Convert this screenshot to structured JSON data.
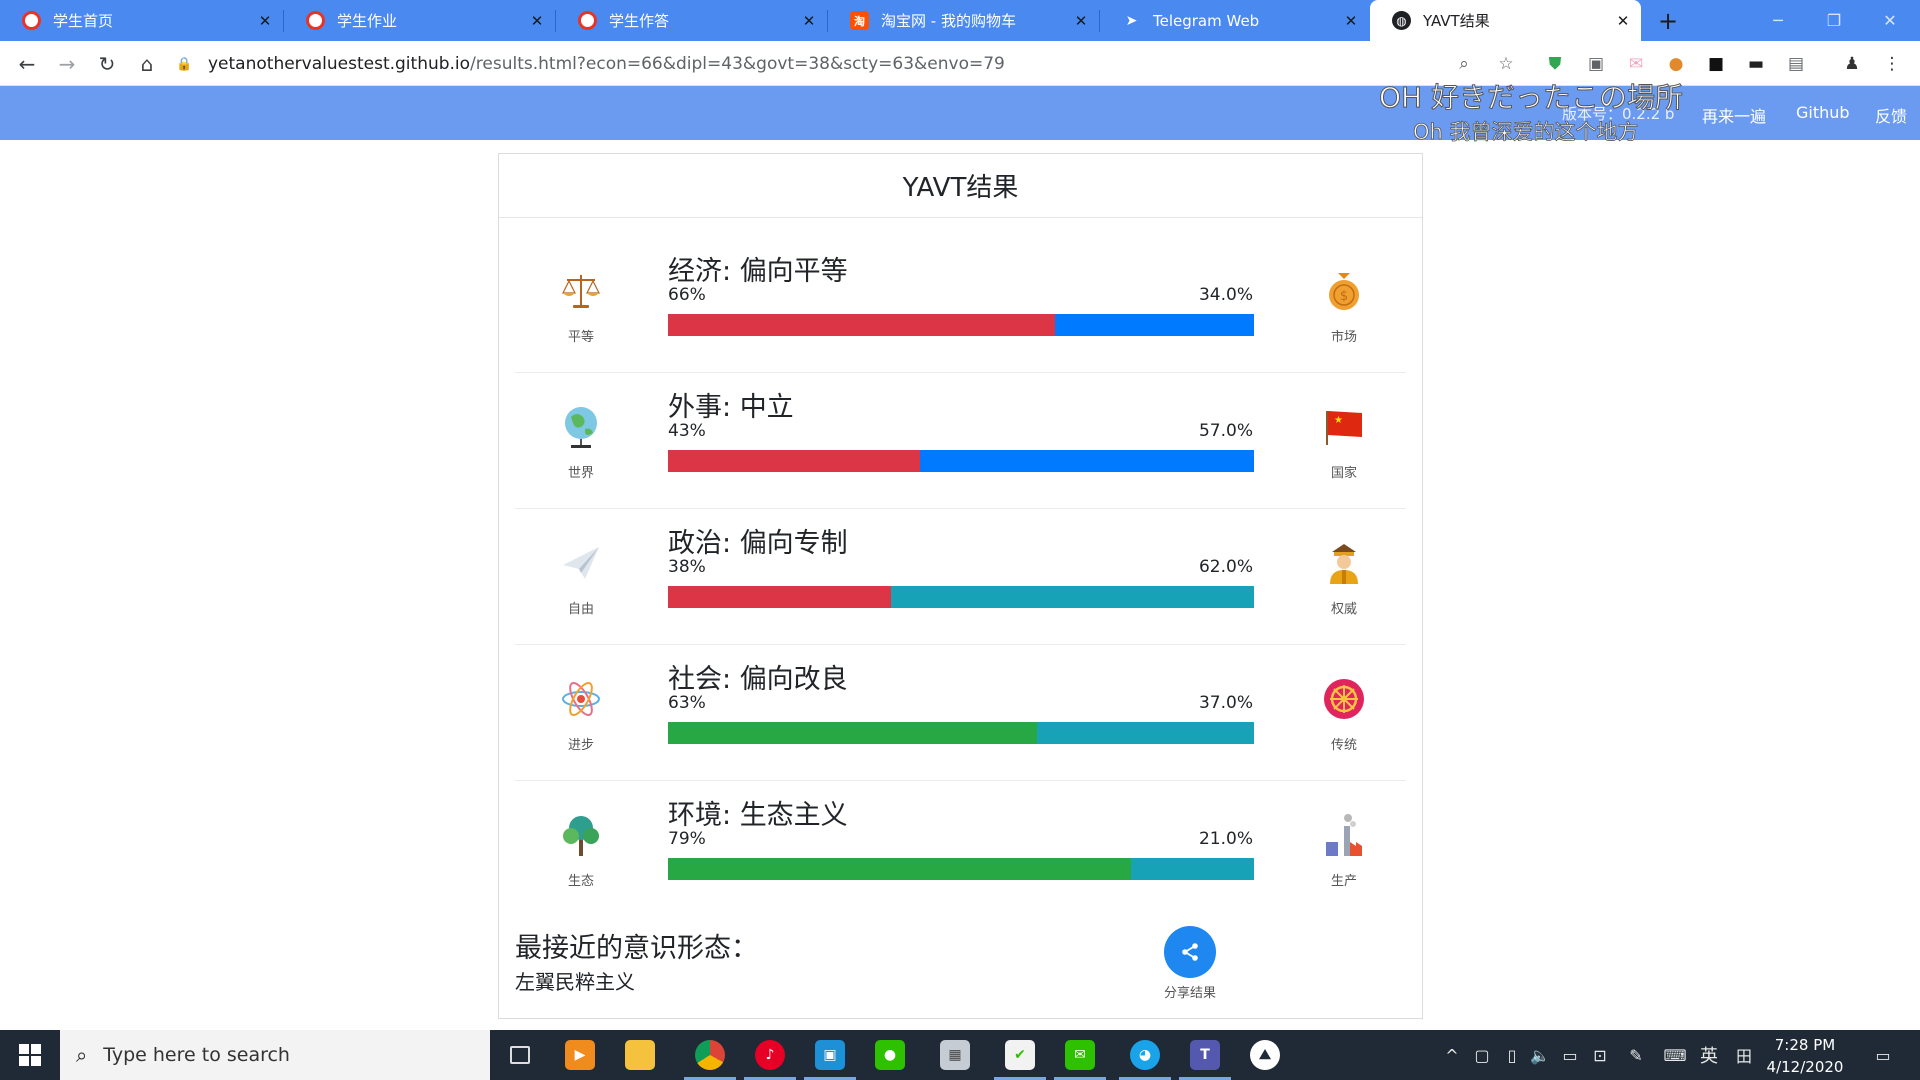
{
  "browser": {
    "tabs": [
      {
        "title": "学生首页",
        "favicon": "school-icon",
        "color": "#e8332a"
      },
      {
        "title": "学生作业",
        "favicon": "school-icon",
        "color": "#e8332a"
      },
      {
        "title": "学生作答",
        "favicon": "school-icon",
        "color": "#e8332a"
      },
      {
        "title": "淘宝网 - 我的购物车",
        "favicon": "taobao-icon",
        "color": "#ff5000"
      },
      {
        "title": "Telegram Web",
        "favicon": "telegram-icon",
        "color": "#2ca5e0"
      },
      {
        "title": "YAVT结果",
        "favicon": "globe-icon",
        "color": "#202124",
        "active": true
      }
    ],
    "url_host": "yetanothervaluestest.github.io",
    "url_path": "/results.html?econ=66&dipl=43&govt=38&scty=63&envo=79"
  },
  "site_nav": {
    "version": "版本号：0.2.2 b",
    "links": [
      "再来一遍",
      "Github",
      "反馈"
    ]
  },
  "overlay_lyrics": {
    "line1": "OH 好きだったこの場所",
    "line2": "Oh 我曾深爱的这个地方"
  },
  "results": {
    "title": "YAVT结果",
    "axes": [
      {
        "category": "经济",
        "verdict": "偏向平等",
        "left_label": "平等",
        "right_label": "市场",
        "left_pct": "66%",
        "right_pct": "34.0%",
        "left_value": 66,
        "left_color": "#dc3545",
        "right_color": "#007bff",
        "left_icon": "scales-icon",
        "right_icon": "money-bag-icon"
      },
      {
        "category": "外事",
        "verdict": "中立",
        "left_label": "世界",
        "right_label": "国家",
        "left_pct": "43%",
        "right_pct": "57.0%",
        "left_value": 43,
        "left_color": "#dc3545",
        "right_color": "#007bff",
        "left_icon": "globe-icon",
        "right_icon": "flag-icon"
      },
      {
        "category": "政治",
        "verdict": "偏向专制",
        "left_label": "自由",
        "right_label": "权威",
        "left_pct": "38%",
        "right_pct": "62.0%",
        "left_value": 38,
        "left_color": "#dc3545",
        "right_color": "#17a2b8",
        "left_icon": "paper-plane-icon",
        "right_icon": "emperor-icon"
      },
      {
        "category": "社会",
        "verdict": "偏向改良",
        "left_label": "进步",
        "right_label": "传统",
        "left_pct": "63%",
        "right_pct": "37.0%",
        "left_value": 63,
        "left_color": "#28a745",
        "right_color": "#17a2b8",
        "left_icon": "atom-icon",
        "right_icon": "dharma-wheel-icon"
      },
      {
        "category": "环境",
        "verdict": "生态主义",
        "left_label": "生态",
        "right_label": "生产",
        "left_pct": "79%",
        "right_pct": "21.0%",
        "left_value": 79,
        "left_color": "#28a745",
        "right_color": "#17a2b8",
        "left_icon": "tree-icon",
        "right_icon": "factory-icon"
      }
    ],
    "closest_ideology_label": "最接近的意识形态：",
    "closest_ideology": "左翼民粹主义",
    "share_label": "分享结果"
  },
  "taskbar": {
    "search_placeholder": "Type here to search",
    "apps": [
      "task-view-icon",
      "media-player-icon",
      "file-explorer-icon",
      "chrome-icon",
      "netease-music-icon",
      "app-window-icon",
      "wechat-icon",
      "printer-icon",
      "photos-icon",
      "wechat-work-icon",
      "qq-icon",
      "teams-icon",
      "onedrive-icon"
    ],
    "ime": "英",
    "time": "7:28 PM",
    "date": "4/12/2020"
  }
}
